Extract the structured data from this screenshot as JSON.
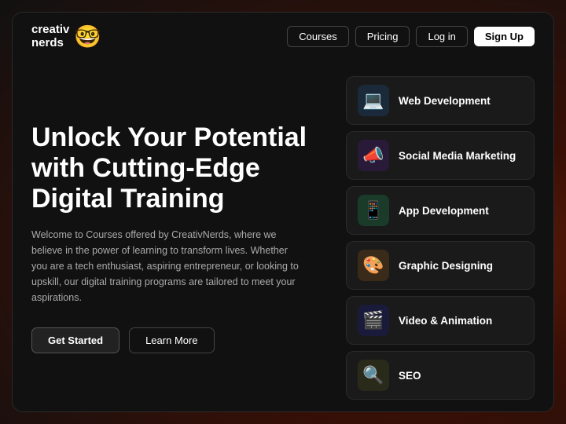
{
  "app": {
    "name": "creativ\nnerds",
    "emoji": "🤓"
  },
  "nav": {
    "links": [
      "Courses",
      "Pricing",
      "Log in"
    ],
    "signup": "Sign Up"
  },
  "hero": {
    "title": "Unlock Your Potential with Cutting-Edge Digital Training",
    "description": "Welcome to Courses offered by CreativNerds, where we believe in the power of learning to transform lives. Whether you are a tech enthusiast, aspiring entrepreneur, or looking to upskill, our digital training programs are tailored to meet your aspirations.",
    "cta_primary": "Get Started",
    "cta_secondary": "Learn More"
  },
  "courses": [
    {
      "name": "Web Development",
      "icon": "💻",
      "icon_class": "icon-web"
    },
    {
      "name": "Social Media Marketing",
      "icon": "📣",
      "icon_class": "icon-smm"
    },
    {
      "name": "App Development",
      "icon": "📱",
      "icon_class": "icon-app"
    },
    {
      "name": "Graphic Designing",
      "icon": "🎨",
      "icon_class": "icon-design"
    },
    {
      "name": "Video & Animation",
      "icon": "🎬",
      "icon_class": "icon-video"
    },
    {
      "name": "SEO",
      "icon": "🔍",
      "icon_class": "icon-seo"
    }
  ]
}
